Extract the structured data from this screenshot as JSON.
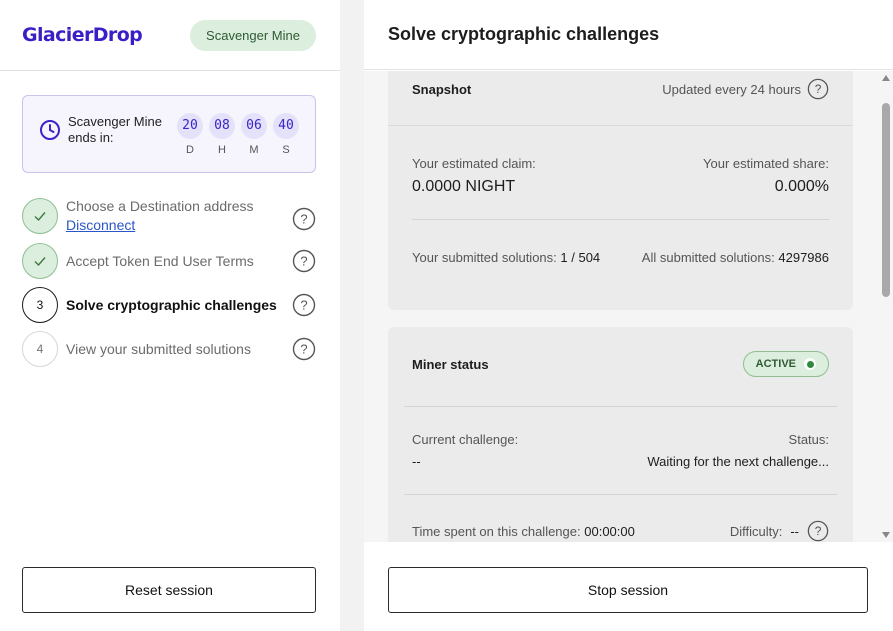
{
  "sidebar": {
    "logo": "GlacierDrop",
    "mine_badge": "Scavenger Mine",
    "countdown": {
      "label": "Scavenger Mine ends in:",
      "units": [
        {
          "value": "20",
          "label": "D"
        },
        {
          "value": "08",
          "label": "H"
        },
        {
          "value": "06",
          "label": "M"
        },
        {
          "value": "40",
          "label": "S"
        }
      ]
    },
    "steps": [
      {
        "marker": "",
        "label": "Choose a Destination address",
        "link": "Disconnect",
        "state": "done"
      },
      {
        "marker": "",
        "label": "Accept Token End User Terms",
        "state": "done"
      },
      {
        "marker": "3",
        "label": "Solve cryptographic challenges",
        "state": "active"
      },
      {
        "marker": "4",
        "label": "View your submitted solutions",
        "state": "todo"
      }
    ],
    "reset_button": "Reset session"
  },
  "main": {
    "title": "Solve cryptographic challenges",
    "snapshot": {
      "title": "Snapshot",
      "updated": "Updated every 24 hours",
      "estimated_claim_label": "Your estimated claim:",
      "estimated_claim_value": "0.0000 NIGHT",
      "estimated_share_label": "Your estimated share:",
      "estimated_share_value": "0.000%",
      "submitted_label": "Your submitted solutions:",
      "submitted_value": "1 / 504",
      "all_submitted_label": "All submitted solutions:",
      "all_submitted_value": "4297986"
    },
    "miner": {
      "title": "Miner status",
      "status_badge": "ACTIVE",
      "current_challenge_label": "Current challenge:",
      "current_challenge_value": "--",
      "status_label": "Status:",
      "status_value": "Waiting for the next challenge...",
      "time_label": "Time spent on this challenge:",
      "time_value": "00:00:00",
      "difficulty_label": "Difficulty:",
      "difficulty_value": "--"
    },
    "stop_button": "Stop session"
  },
  "colors": {
    "brand": "#3b1fc6",
    "success_bg": "#dceedd",
    "success_dot": "#2e8b3e",
    "countdown_bg": "#f6f5fd"
  }
}
